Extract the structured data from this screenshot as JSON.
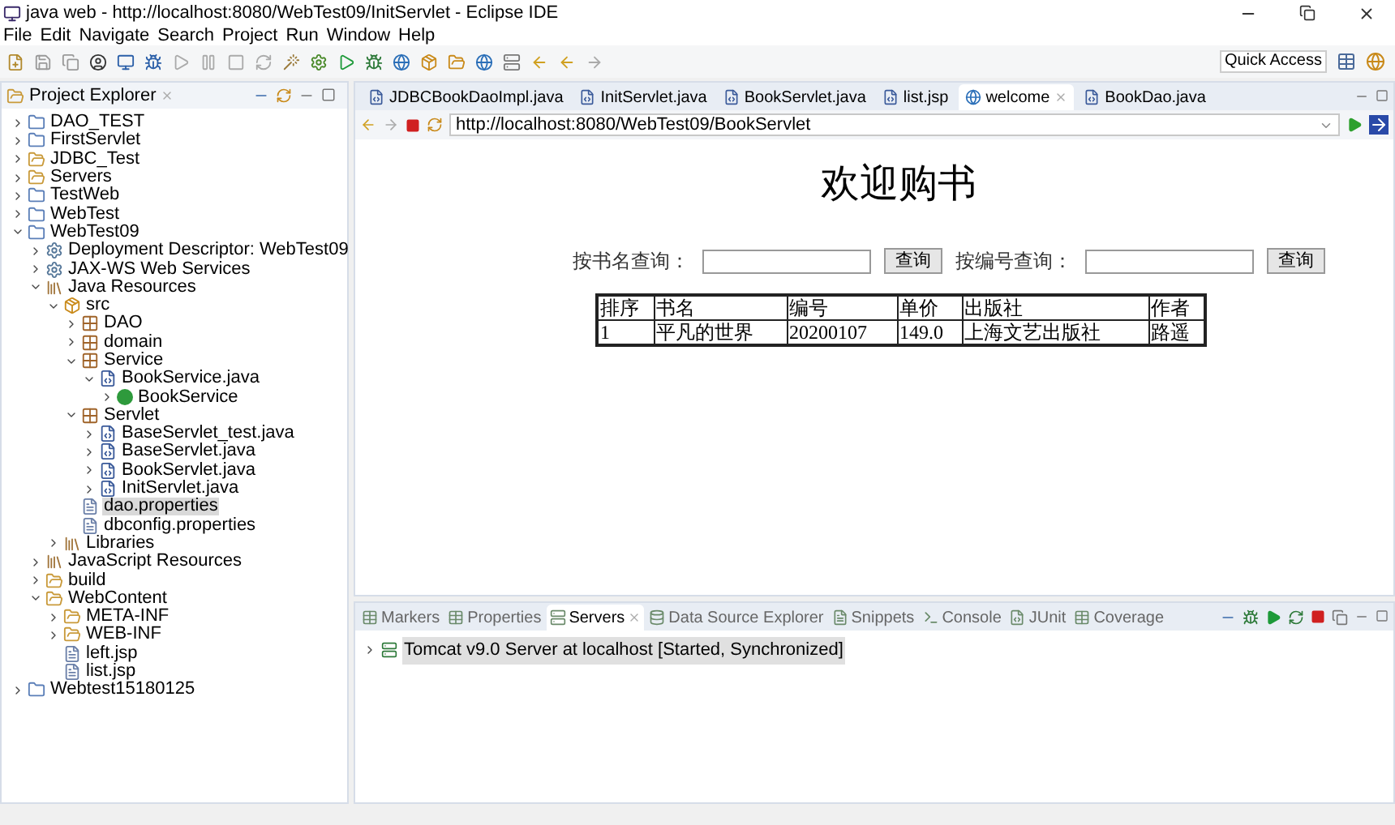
{
  "window": {
    "title": "java web - http://localhost:8080/WebTest09/InitServlet - Eclipse IDE"
  },
  "menu": [
    "File",
    "Edit",
    "Navigate",
    "Search",
    "Project",
    "Run",
    "Window",
    "Help"
  ],
  "quick_access": "Quick Access",
  "project_explorer": {
    "title": "Project Explorer",
    "items": [
      {
        "label": "DAO_TEST",
        "kind": "project",
        "expanded": false
      },
      {
        "label": "FirstServlet",
        "kind": "project",
        "expanded": false
      },
      {
        "label": "JDBC_Test",
        "kind": "folder",
        "expanded": false
      },
      {
        "label": "Servers",
        "kind": "folder",
        "expanded": false
      },
      {
        "label": "TestWeb",
        "kind": "project",
        "expanded": false
      },
      {
        "label": "WebTest",
        "kind": "project",
        "expanded": false
      },
      {
        "label": "WebTest09",
        "kind": "project",
        "expanded": true,
        "children": [
          {
            "label": "Deployment Descriptor: WebTest09",
            "kind": "descriptor",
            "expanded": false
          },
          {
            "label": "JAX-WS Web Services",
            "kind": "descriptor",
            "expanded": false
          },
          {
            "label": "Java Resources",
            "kind": "library",
            "expanded": true,
            "children": [
              {
                "label": "src",
                "kind": "source",
                "expanded": true,
                "children": [
                  {
                    "label": "DAO",
                    "kind": "package",
                    "expanded": false
                  },
                  {
                    "label": "domain",
                    "kind": "package",
                    "expanded": false
                  },
                  {
                    "label": "Service",
                    "kind": "package",
                    "expanded": true,
                    "children": [
                      {
                        "label": "BookService.java",
                        "kind": "java",
                        "expanded": true,
                        "children": [
                          {
                            "label": "BookService",
                            "kind": "class",
                            "expanded": false
                          }
                        ]
                      }
                    ]
                  },
                  {
                    "label": "Servlet",
                    "kind": "package",
                    "expanded": true,
                    "children": [
                      {
                        "label": "BaseServlet_test.java",
                        "kind": "java",
                        "expanded": false
                      },
                      {
                        "label": "BaseServlet.java",
                        "kind": "java",
                        "expanded": false
                      },
                      {
                        "label": "BookServlet.java",
                        "kind": "java",
                        "expanded": false
                      },
                      {
                        "label": "InitServlet.java",
                        "kind": "java",
                        "expanded": false
                      }
                    ]
                  },
                  {
                    "label": "dao.properties",
                    "kind": "file",
                    "selected": true
                  },
                  {
                    "label": "dbconfig.properties",
                    "kind": "file",
                    "selected": false
                  }
                ]
              },
              {
                "label": "Libraries",
                "kind": "library",
                "expanded": false
              }
            ]
          },
          {
            "label": "JavaScript Resources",
            "kind": "library",
            "expanded": false
          },
          {
            "label": "build",
            "kind": "folder",
            "expanded": false
          },
          {
            "label": "WebContent",
            "kind": "folder",
            "expanded": true,
            "children": [
              {
                "label": "META-INF",
                "kind": "folder",
                "expanded": false
              },
              {
                "label": "WEB-INF",
                "kind": "folder",
                "expanded": false
              },
              {
                "label": "left.jsp",
                "kind": "file",
                "selected": false
              },
              {
                "label": "list.jsp",
                "kind": "file",
                "selected": false
              }
            ]
          }
        ]
      },
      {
        "label": "Webtest15180125",
        "kind": "project",
        "expanded": false
      }
    ]
  },
  "editor_tabs": [
    {
      "label": "JDBCBookDaoImpl.java",
      "selected": false
    },
    {
      "label": "InitServlet.java",
      "selected": false
    },
    {
      "label": "BookServlet.java",
      "selected": false
    },
    {
      "label": "list.jsp",
      "selected": false
    },
    {
      "label": "welcome",
      "selected": true
    },
    {
      "label": "BookDao.java",
      "selected": false
    }
  ],
  "browser": {
    "url": "http://localhost:8080/WebTest09/BookServlet"
  },
  "page": {
    "heading": "欢迎购书",
    "search": [
      {
        "label": "按书名查询：",
        "button": "查询"
      },
      {
        "label": "按编号查询：",
        "button": "查询"
      }
    ],
    "table": {
      "columns": [
        "排序",
        "书名",
        "编号",
        "单价",
        "出版社",
        "作者"
      ],
      "rows": [
        [
          "1",
          "平凡的世界",
          "20200107",
          "149.0",
          "上海文艺出版社",
          "路遥"
        ]
      ]
    }
  },
  "bottom_tabs": [
    {
      "label": "Markers",
      "selected": false
    },
    {
      "label": "Properties",
      "selected": false
    },
    {
      "label": "Servers",
      "selected": true
    },
    {
      "label": "Data Source Explorer",
      "selected": false
    },
    {
      "label": "Snippets",
      "selected": false
    },
    {
      "label": "Console",
      "selected": false
    },
    {
      "label": "JUnit",
      "selected": false
    },
    {
      "label": "Coverage",
      "selected": false
    }
  ],
  "servers": [
    {
      "name": "Tomcat v9.0 Server at localhost",
      "status": "[Started, Synchronized]"
    }
  ]
}
